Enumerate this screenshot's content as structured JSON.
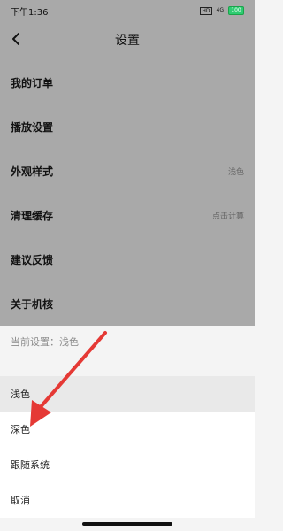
{
  "status_bar": {
    "time": "下午1:36",
    "hd": "HD",
    "network": "4G",
    "battery": "100"
  },
  "header": {
    "title": "设置",
    "back_icon": "chevron-left-icon"
  },
  "menu": [
    {
      "label": "我的订单",
      "value": ""
    },
    {
      "label": "播放设置",
      "value": ""
    },
    {
      "label": "外观样式",
      "value": "浅色"
    },
    {
      "label": "清理缓存",
      "value": "点击计算"
    },
    {
      "label": "建议反馈",
      "value": ""
    },
    {
      "label": "关于机核",
      "value": ""
    }
  ],
  "sheet": {
    "current_setting": "当前设置：浅色",
    "options": [
      "浅色",
      "深色",
      "跟随系统",
      "取消"
    ]
  },
  "colors": {
    "dim_overlay": "#a9a9a9",
    "sheet_bg": "#f4f4f4",
    "arrow_red": "#e53935",
    "battery_green": "#2ecc71"
  }
}
